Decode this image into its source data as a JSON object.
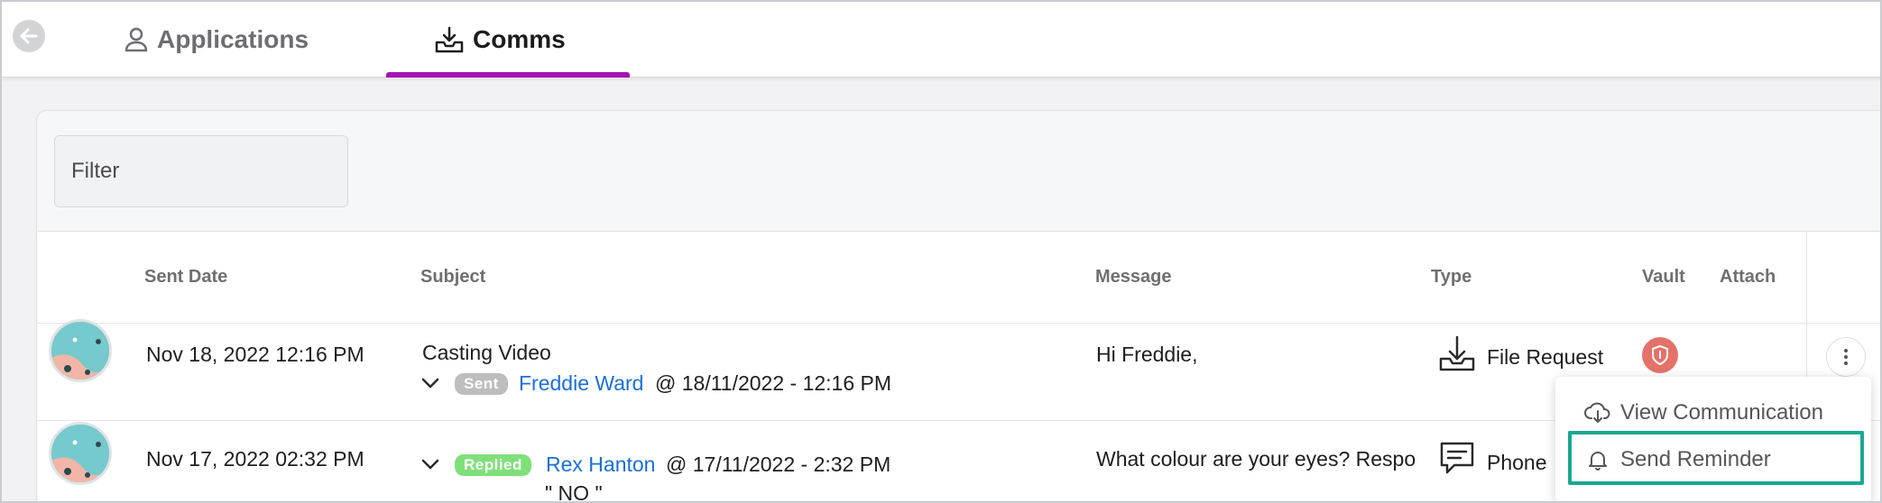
{
  "tabs": [
    {
      "label": "Applications",
      "icon": "user-icon",
      "active": false
    },
    {
      "label": "Comms",
      "icon": "inbox-download-icon",
      "active": true
    }
  ],
  "accent_color": "#a314b3",
  "filter": {
    "placeholder": "Filter"
  },
  "table": {
    "headers": [
      "Sent Date",
      "Subject",
      "Message",
      "Type",
      "Vault",
      "Attach"
    ],
    "rows": [
      {
        "sent_date": "Nov 18, 2022 12:16 PM",
        "subject": "Casting Video",
        "status": "Sent",
        "contact": "Freddie Ward",
        "timestamp": "@ 18/11/2022 - 12:16 PM",
        "reply": "",
        "message": "Hi Freddie,",
        "type": "File Request",
        "type_icon": "file-download-icon",
        "vault_icon": "shield-icon"
      },
      {
        "sent_date": "Nov 17, 2022 02:32 PM",
        "subject": "",
        "status": "Replied",
        "contact": "Rex Hanton",
        "timestamp": "@ 17/11/2022 - 2:32 PM",
        "reply": "\" NO \"",
        "message": "What colour are your eyes? Respo",
        "type": "Phone",
        "type_icon": "chat-icon"
      }
    ]
  },
  "context_menu": {
    "items": [
      {
        "label": "View Communication",
        "icon": "cloud-download-icon"
      },
      {
        "label": "Send Reminder",
        "icon": "bell-icon",
        "highlighted": true
      }
    ]
  }
}
